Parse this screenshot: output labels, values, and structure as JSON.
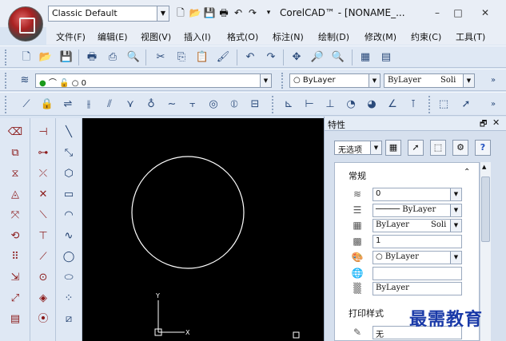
{
  "workspace": {
    "value": "Classic Default"
  },
  "window": {
    "title": "CorelCAD™ - [NONAME_...",
    "minimize": "–",
    "maximize": "□",
    "close": "✕"
  },
  "menu": [
    "文件(F)",
    "编辑(E)",
    "视图(V)",
    "插入(I)",
    "格式(O)",
    "标注(N)",
    "绘制(D)",
    "修改(M)",
    "约束(C)",
    "工具(T)"
  ],
  "layer_bar": {
    "layer_value": "0",
    "color_value": "ByLayer",
    "linetype_value": "ByLayer",
    "lineweight_value": "Soli"
  },
  "properties": {
    "title": "特性",
    "selection": "无选项",
    "group_general": "常规",
    "rows": [
      "0",
      "ByLayer",
      "ByLayer",
      "Soli",
      "1",
      "ByLayer",
      "ByLayer"
    ],
    "group_print": "打印样式",
    "print_value": "无"
  },
  "canvas": {
    "x_axis": "X",
    "y_axis": "Y"
  },
  "watermark": "最需教育",
  "colors": {
    "canvas": "#000000",
    "accent": "#1a3aa8",
    "toolbar": "#dfe8f4"
  }
}
